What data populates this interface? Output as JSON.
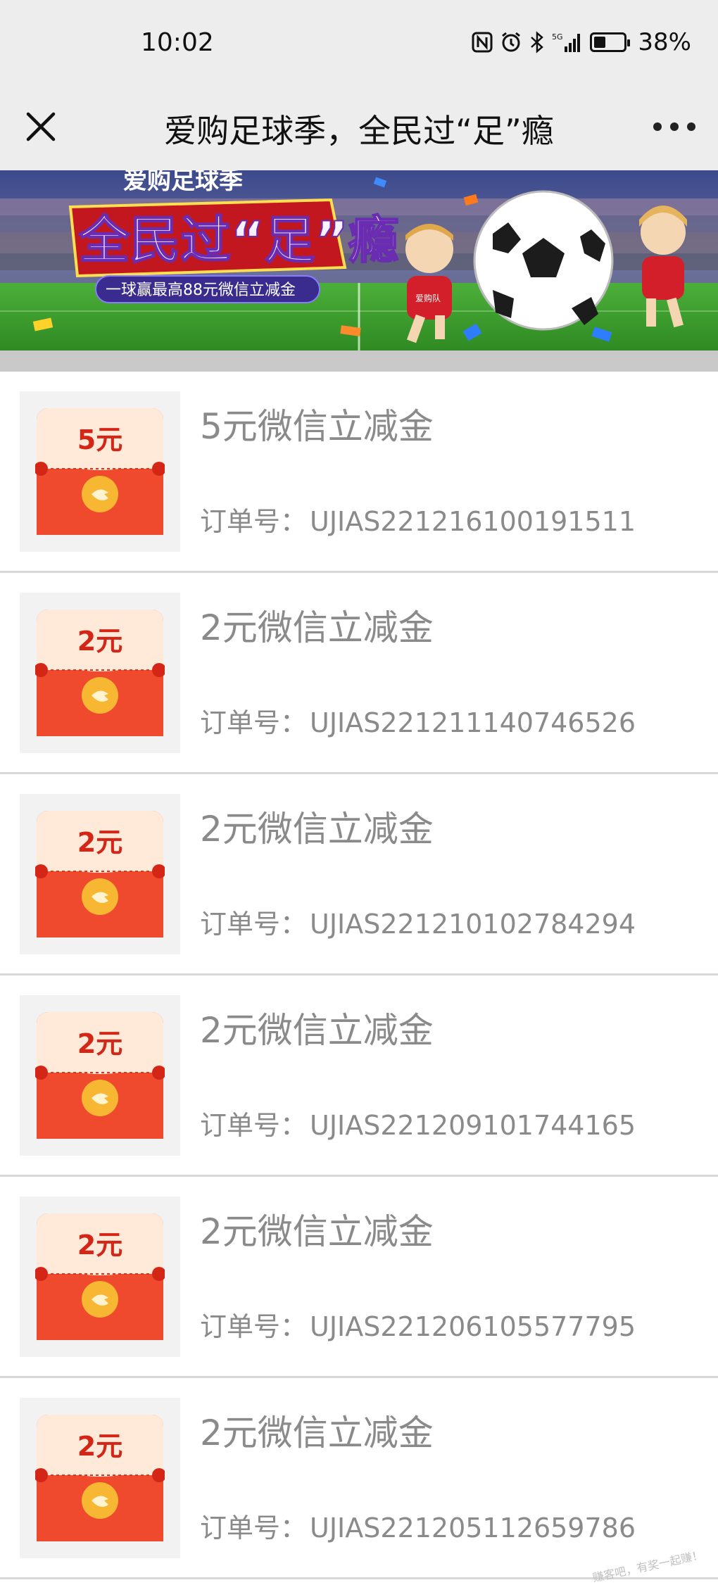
{
  "status_bar": {
    "time": "10:02",
    "network": "5G",
    "battery_percent": "38%",
    "battery_level": 0.38
  },
  "nav": {
    "title": "爱购足球季，全民过“足”瘾"
  },
  "banner": {
    "top_text": "爱购足球季",
    "headline": "全民过“足”瘾",
    "subline": "一球赢最高88元微信立减金",
    "jersey_text": "爱购队"
  },
  "items": [
    {
      "amount": "5元",
      "title": "5元微信立减金",
      "order_label": "订单号：",
      "order_no": "UJIAS221216100191511"
    },
    {
      "amount": "2元",
      "title": "2元微信立减金",
      "order_label": "订单号：",
      "order_no": "UJIAS221211140746526"
    },
    {
      "amount": "2元",
      "title": "2元微信立减金",
      "order_label": "订单号：",
      "order_no": "UJIAS221210102784294"
    },
    {
      "amount": "2元",
      "title": "2元微信立减金",
      "order_label": "订单号：",
      "order_no": "UJIAS221209101744165"
    },
    {
      "amount": "2元",
      "title": "2元微信立减金",
      "order_label": "订单号：",
      "order_no": "UJIAS221206105577795"
    },
    {
      "amount": "2元",
      "title": "2元微信立减金",
      "order_label": "订单号：",
      "order_no": "UJIAS221205112659786"
    }
  ],
  "watermark": "赚客吧，有奖一起赚！",
  "colors": {
    "envelope_red": "#f04a2e",
    "envelope_top": "#ffe9d9",
    "coin_gold": "#f7b733",
    "text_gray": "#8a8a8a",
    "nav_bg": "#ededed"
  }
}
